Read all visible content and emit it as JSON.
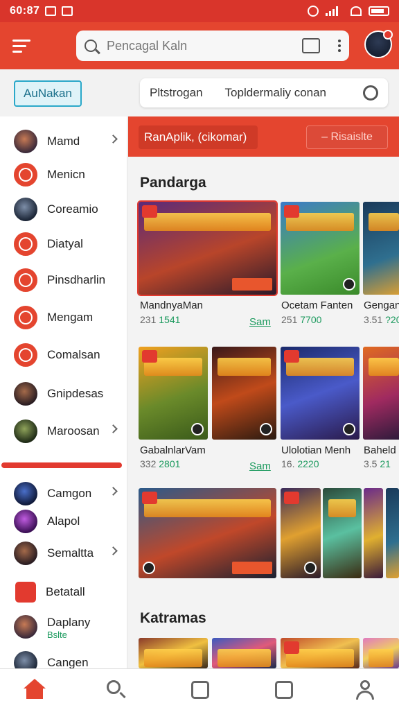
{
  "status": {
    "time": "60:87"
  },
  "search": {
    "placeholder": "Pencagal Kaln"
  },
  "header": {
    "pill_label": "AuNakan"
  },
  "filter": {
    "left": "Pltstrogan",
    "right": "Topldermaliy conan"
  },
  "sidebar": {
    "items": [
      {
        "label": "Mamd",
        "icon": "avatar-icon",
        "chevron": true
      },
      {
        "label": "Menicn",
        "icon": "bookmark-icon",
        "chevron": false
      },
      {
        "label": "Coreamio",
        "icon": "avatar-icon",
        "chevron": false
      },
      {
        "label": "Diatyal",
        "icon": "ear-icon",
        "chevron": false
      },
      {
        "label": "Pinsdharlin",
        "icon": "book-icon",
        "chevron": false
      },
      {
        "label": "Mengam",
        "icon": "puzzle-icon",
        "chevron": false
      },
      {
        "label": "Comalsan",
        "icon": "shield-icon",
        "chevron": false
      },
      {
        "label": "Gnipdesas",
        "icon": "avatar-icon",
        "chevron": false
      },
      {
        "label": "Maroosan",
        "icon": "avatar-icon",
        "chevron": true
      }
    ],
    "items2": [
      {
        "label": "Camgon",
        "icon": "game-icon",
        "chevron": true
      },
      {
        "label": "Alapol",
        "icon": "app-icon",
        "chevron": false
      },
      {
        "label": "Semaltta",
        "icon": "game-icon",
        "chevron": true
      },
      {
        "label": "Betatall",
        "icon": "grid-icon",
        "chevron": false
      },
      {
        "label": "Daplany",
        "sub": "Bslte",
        "icon": "game-icon",
        "chevron": false
      },
      {
        "label": "Cangen",
        "icon": "game-icon",
        "chevron": false
      }
    ]
  },
  "tabs": {
    "active": "RanAplik, (cikomar)",
    "button": "– Risaislte"
  },
  "sections": {
    "first": "Pandarga",
    "second": "Katramas"
  },
  "row1": [
    {
      "name": "MandnyaMan",
      "num1": "231",
      "num2": "1541",
      "link": "Sam"
    },
    {
      "name": "Ocetam Fanten",
      "num1": "251",
      "num2": "7700"
    },
    {
      "name": "Gengan",
      "num1": "3.51",
      "num2": "?20"
    }
  ],
  "row2": [
    {
      "name": "GabalnlarVam",
      "num1": "332",
      "num2": "2801",
      "link": "Sam"
    },
    {
      "name": "Ulolotian Menh",
      "num1": "16.",
      "num2": "2220"
    },
    {
      "name": "Baheld",
      "num1": "3.5",
      "num2": "21"
    }
  ],
  "colors": {
    "primary": "#e4452f",
    "statusbar": "#d9352b",
    "accent_green": "#1c9a5e",
    "pill_border": "#2aa8c9"
  }
}
